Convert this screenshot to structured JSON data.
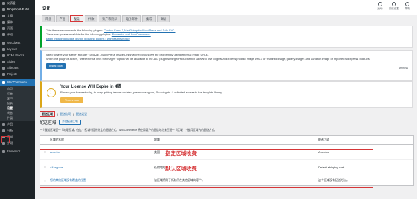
{
  "sidebar": {
    "items": [
      {
        "label": "仪表盘",
        "icon": "dashboard-icon"
      },
      {
        "label": "Dropship & Fulfill",
        "icon": "truck-icon"
      },
      {
        "label": "文章",
        "icon": "pin-icon"
      },
      {
        "label": "媒体",
        "icon": "media-icon"
      },
      {
        "label": "页面",
        "icon": "page-icon"
      },
      {
        "label": "评论",
        "icon": "comment-icon"
      },
      {
        "label": "WoodMart",
        "icon": "woodmart-icon"
      },
      {
        "label": "Layouts",
        "icon": "layout-icon"
      },
      {
        "label": "HTML Blocks",
        "icon": "html-icon"
      },
      {
        "label": "Slides",
        "icon": "slides-icon"
      },
      {
        "label": "Sidebars",
        "icon": "sidebar-icon"
      },
      {
        "label": "Projects",
        "icon": "projects-icon"
      },
      {
        "label": "WooCommerce",
        "icon": "woo-icon"
      }
    ],
    "submenu": [
      "首页",
      "订单",
      "客户",
      "报表",
      "设置",
      "状态",
      "扩展"
    ],
    "submenu_current": "设置",
    "bottom": [
      {
        "label": "产品",
        "icon": "box-icon"
      },
      {
        "label": "分析",
        "icon": "analytics-icon"
      },
      {
        "label": "营销",
        "icon": "megaphone-icon"
      },
      {
        "label": "外观",
        "icon": "brush-icon"
      },
      {
        "label": "Elementor",
        "icon": "elementor-icon"
      }
    ]
  },
  "topbar": {
    "title": "设置",
    "icons": [
      {
        "label": "活动",
        "icon": "inbox-icon"
      },
      {
        "label": "完成设置",
        "icon": "check-icon"
      },
      {
        "label": "帮助",
        "icon": "help-icon"
      }
    ]
  },
  "tabs": [
    "常规",
    "产品",
    "配送",
    "付款",
    "账户和隐私",
    "电子邮件",
    "集成",
    "高级"
  ],
  "active_tab": "配送",
  "notices": {
    "plugins": {
      "line1": "This theme recommends the following plugins:",
      "line1_links": "Contact Form 7, MailChimp for WordPress and Safe SVG.",
      "line2": "There are updates available for the following plugins:",
      "line2_links": "Elementor and WooCommerce.",
      "line3": "Begin installing plugins | Begin updating plugins | Dismiss this notice"
    },
    "alidswoo": {
      "line1": "Need to save your server storage? DMAZE - WordPress Image Links will help you solve the problem by using external image URLs.",
      "line2": "When this plugin is active, \"Use external links for images\" option will be available in the ALD plugin settings/Product which allows to use original AliExpress product image URLs for featured image, gallery images and variation image of imported AliExpress products.",
      "button": "Install now",
      "dismiss": "Dismiss"
    },
    "license": {
      "icon_text": "!",
      "title": "Your License Will Expire in 4周",
      "text": "Renew your license today, to keep getting feature updates, premium support, Pro widgets & unlimited access to the template library.",
      "button": "Renew now"
    }
  },
  "subsub": {
    "current": "配送区域",
    "links": [
      "配送选项",
      "配送类型"
    ]
  },
  "heading": {
    "title": "配送区域",
    "add_button": "添加配送区域",
    "description": "一个配送区域是一个地理区域，在这个区域内提供特定的配送方式。WooCommerce 将使用客户的配送地址来匹配一个区域，并使用区域内的配送方式。"
  },
  "table": {
    "columns": [
      "区域的名称",
      "地域",
      "配送方式"
    ],
    "rows": [
      {
        "name": "America",
        "region": "美国",
        "method": "America"
      },
      {
        "name": "All regions",
        "region": "任何地方",
        "method": "Default shipping cost"
      }
    ],
    "footer": {
      "name": "您的其他区域没有覆盖的位置",
      "region": "该区域将用于所有不在其他区域的客户。",
      "method": "这个区域没有配送方法。"
    }
  },
  "annotations": [
    "指定区域收费",
    "默认区域收费"
  ]
}
